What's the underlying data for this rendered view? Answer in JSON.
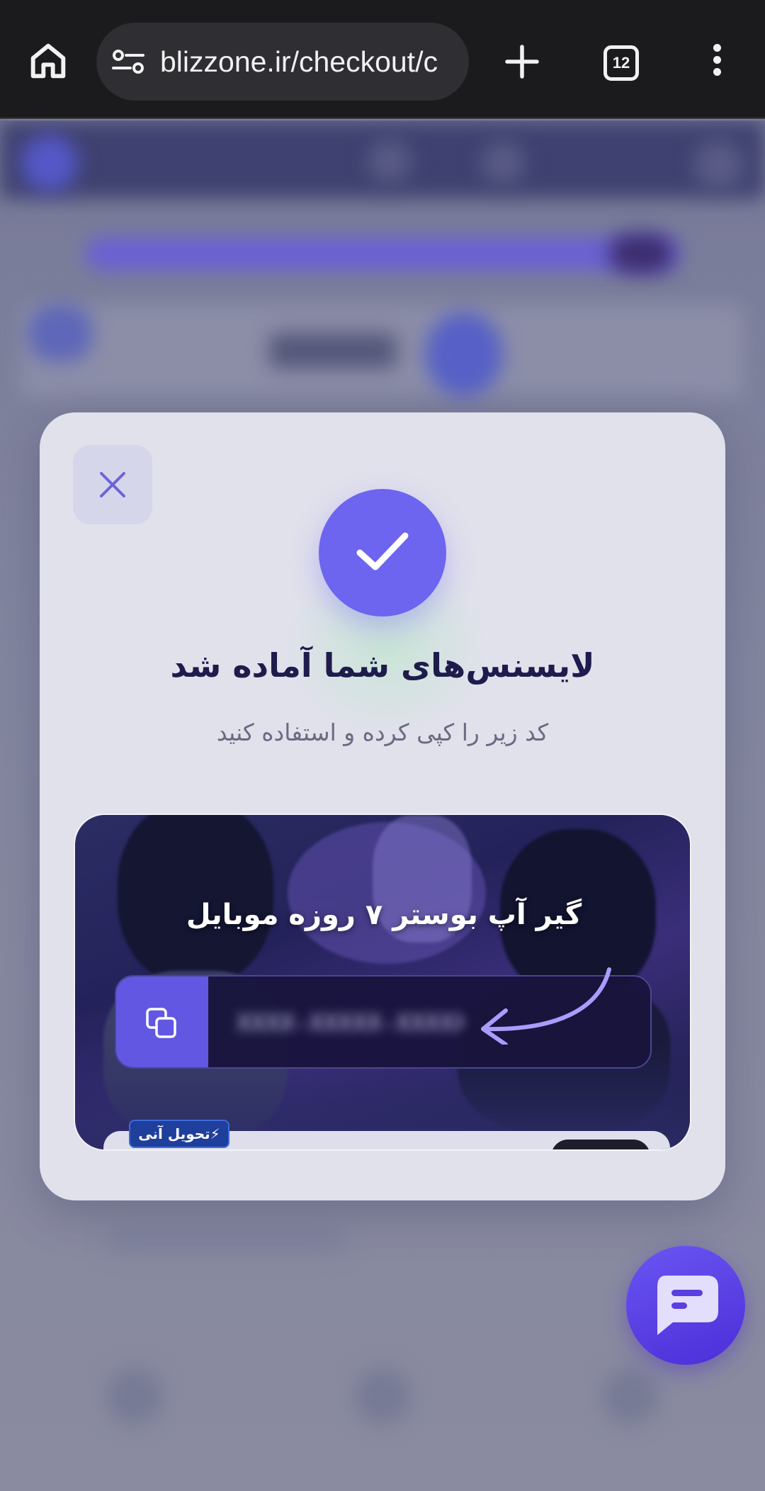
{
  "browser": {
    "url": "blizzone.ir/checkout/c",
    "tab_count": "12"
  },
  "modal": {
    "title": "لایسنس‌های شما آماده شد",
    "subtitle": "کد زیر را کپی کرده و استفاده کنید",
    "accent_color": "#6d64f0"
  },
  "product": {
    "name": "گیر آپ بوستر ۷ روزه موبایل",
    "license_code": "XXXX-XXXXX-XXXXX",
    "badge": "تحویل آنی"
  },
  "icons": {
    "home": "home-icon",
    "site_settings": "tune-icon",
    "new_tab": "plus-icon",
    "menu": "more-vert-icon",
    "close": "close-icon",
    "success": "check-icon",
    "copy": "copy-icon",
    "chat": "chat-icon"
  }
}
